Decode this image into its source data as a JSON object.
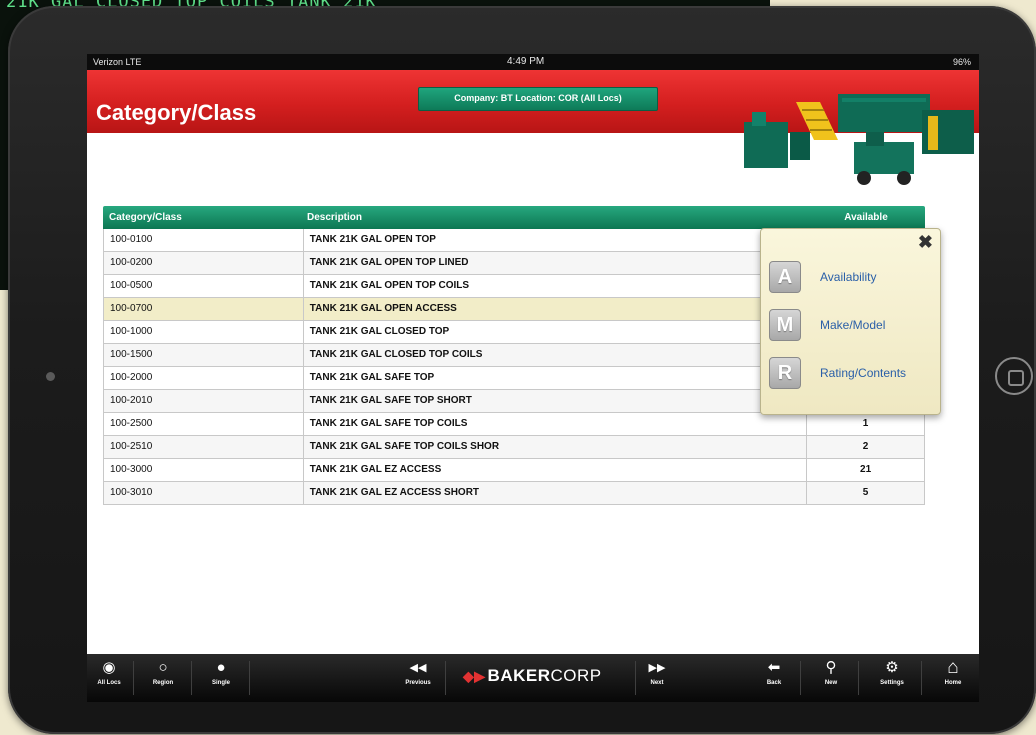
{
  "terminal": {
    "text": "21K GAL CLOSED TOP COILS     TANK 21K"
  },
  "status_bar": {
    "carrier": "Verizon LTE",
    "time": "4:49 PM",
    "battery": "96%"
  },
  "header": {
    "title": "Category/Class",
    "company_badge": "Company: BT Location: COR   (All Locs)"
  },
  "table": {
    "columns": [
      "Category/Class",
      "Description",
      "Available"
    ],
    "rows": [
      {
        "code": "100-0100",
        "description": "TANK 21K GAL OPEN TOP",
        "available": ""
      },
      {
        "code": "100-0200",
        "description": "TANK 21K GAL OPEN TOP LINED",
        "available": ""
      },
      {
        "code": "100-0500",
        "description": "TANK 21K GAL OPEN TOP COILS",
        "available": ""
      },
      {
        "code": "100-0700",
        "description": "TANK 21K GAL OPEN ACCESS",
        "available": ""
      },
      {
        "code": "100-1000",
        "description": "TANK 21K GAL CLOSED TOP",
        "available": ""
      },
      {
        "code": "100-1500",
        "description": "TANK 21K GAL CLOSED TOP COILS",
        "available": ""
      },
      {
        "code": "100-2000",
        "description": "TANK 21K GAL SAFE TOP",
        "available": ""
      },
      {
        "code": "100-2010",
        "description": "TANK 21K GAL SAFE TOP SHORT",
        "available": ""
      },
      {
        "code": "100-2500",
        "description": "TANK 21K GAL SAFE TOP COILS",
        "available": "1"
      },
      {
        "code": "100-2510",
        "description": "TANK 21K GAL SAFE TOP COILS SHOR",
        "available": "2"
      },
      {
        "code": "100-3000",
        "description": "TANK 21K GAL EZ ACCESS",
        "available": "21"
      },
      {
        "code": "100-3010",
        "description": "TANK 21K GAL EZ ACCESS SHORT",
        "available": "5"
      }
    ],
    "selected_row": 3
  },
  "popup": {
    "close": "✖",
    "items": [
      {
        "letter": "A",
        "label": "Availability"
      },
      {
        "letter": "M",
        "label": "Make/Model"
      },
      {
        "letter": "R",
        "label": "Rating/Contents"
      }
    ]
  },
  "toolbar": {
    "left": [
      {
        "icon": "target-icon",
        "glyph": "◉",
        "label": "All Locs"
      },
      {
        "icon": "ring-icon",
        "glyph": "○",
        "label": "Region"
      },
      {
        "icon": "dot-icon",
        "glyph": "●",
        "label": "Single"
      }
    ],
    "previous": {
      "icon": "rewind-icon",
      "glyph": "◀◀",
      "label": "Previous"
    },
    "brand": {
      "bold": "BAKER",
      "light": "CORP"
    },
    "next": {
      "icon": "fast-forward-icon",
      "glyph": "▶▶",
      "label": "Next"
    },
    "right": [
      {
        "icon": "back-arrow-icon",
        "glyph": "⬅",
        "label": "Back"
      },
      {
        "icon": "magnifier-icon",
        "glyph": "⚲",
        "label": "New"
      },
      {
        "icon": "gear-icon",
        "glyph": "⚙",
        "label": "Settings"
      },
      {
        "icon": "home-icon",
        "glyph": "⌂",
        "label": "Home"
      }
    ]
  },
  "colors": {
    "header_red": "#d41f1f",
    "table_header_green": "#0c7652",
    "selected_row": "#f2edc8",
    "popup_link": "#2a5fa8"
  }
}
